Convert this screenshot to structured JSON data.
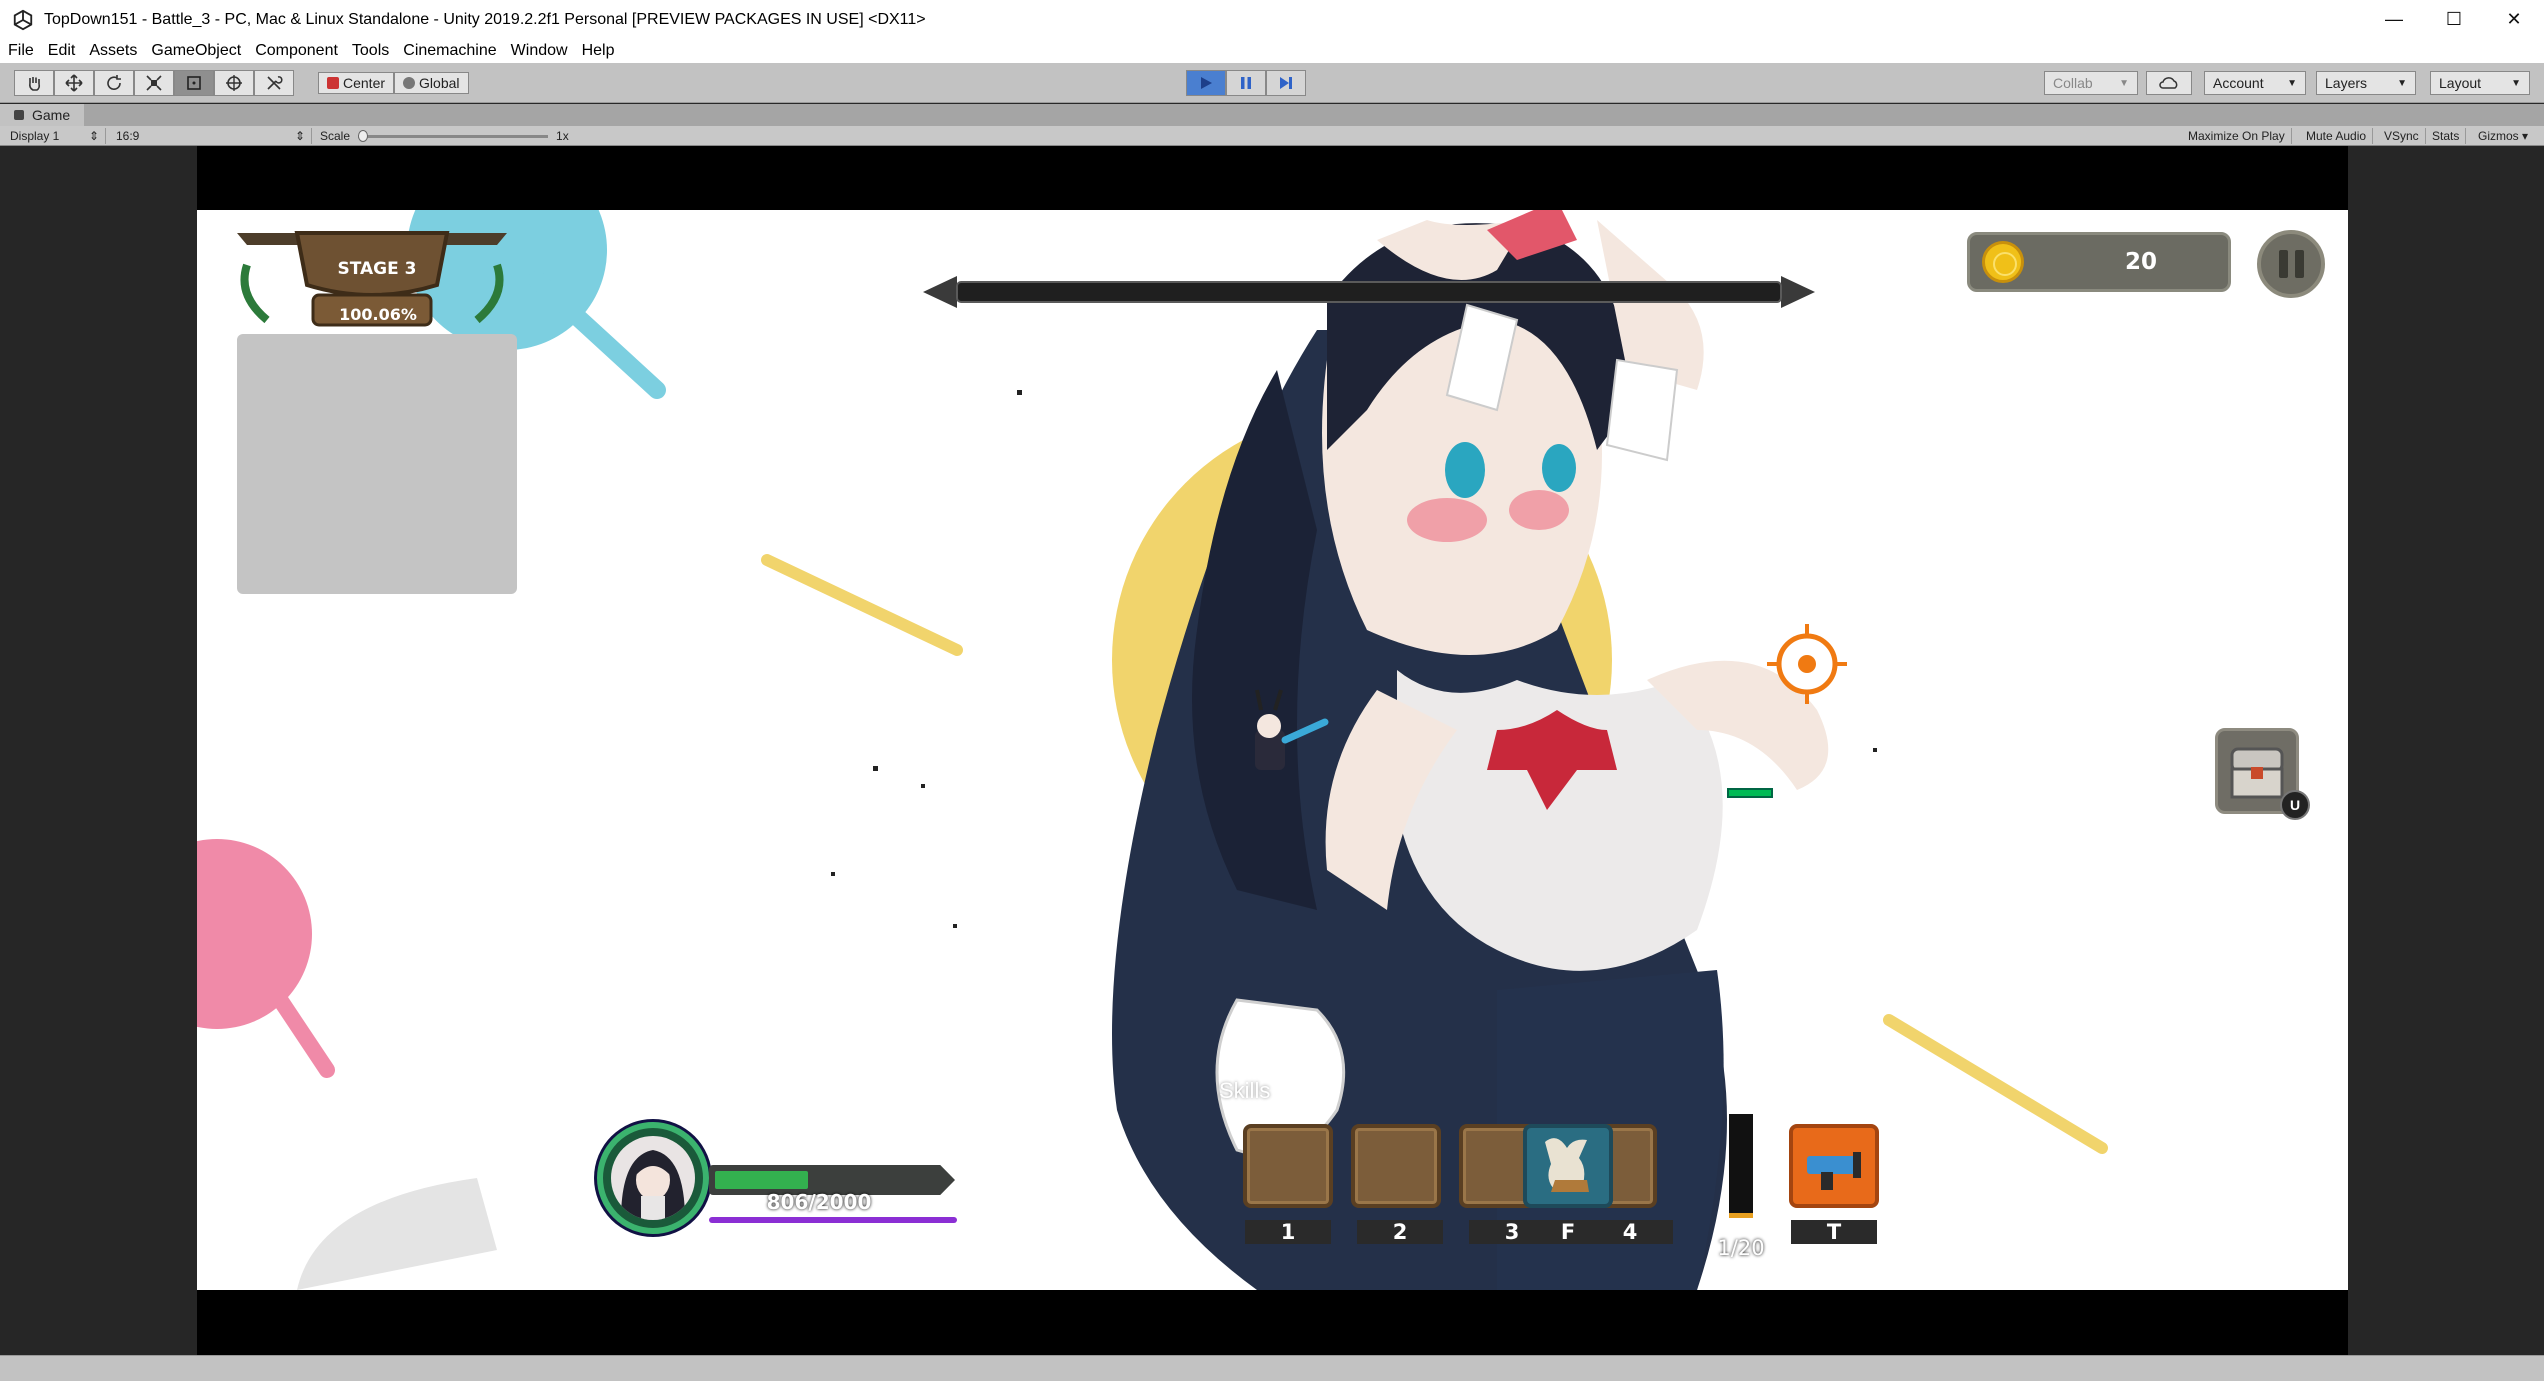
{
  "window": {
    "title": "TopDown151 - Battle_3 - PC, Mac & Linux Standalone - Unity 2019.2.2f1 Personal [PREVIEW PACKAGES IN USE] <DX11>",
    "minimize": "—",
    "maximize": "☐",
    "close": "✕"
  },
  "menu": [
    "File",
    "Edit",
    "Assets",
    "GameObject",
    "Component",
    "Tools",
    "Cinemachine",
    "Window",
    "Help"
  ],
  "toolbar": {
    "pivot": "Center",
    "space": "Global",
    "collab": "Collab",
    "account": "Account",
    "layers": "Layers",
    "layout": "Layout",
    "play_state": "playing"
  },
  "game_view": {
    "tab": "Game",
    "display": "Display 1",
    "aspect": "16:9",
    "scale_label": "Scale",
    "scale_value": "1x",
    "maximize_on_play": "Maximize On Play",
    "mute_audio": "Mute Audio",
    "vsync": "VSync",
    "stats": "Stats",
    "gizmos": "Gizmos"
  },
  "hud": {
    "stage": "STAGE 3",
    "stage_progress": "100.06%",
    "coins": "20",
    "skills_label": "Skills",
    "skill_keys": [
      "1",
      "2",
      "3",
      "4"
    ],
    "special_key": "F",
    "weapon_key": "T",
    "ammo": "1/20",
    "ammo_fraction": 0.05,
    "hp": "806/2000",
    "hp_fraction": 0.4,
    "chest_key": "U",
    "colors": {
      "hp_green": "#33b14f",
      "mp_purple": "#8b2fd4",
      "crosshair_orange": "#f07a12",
      "coin_gold": "#f0c018"
    }
  }
}
